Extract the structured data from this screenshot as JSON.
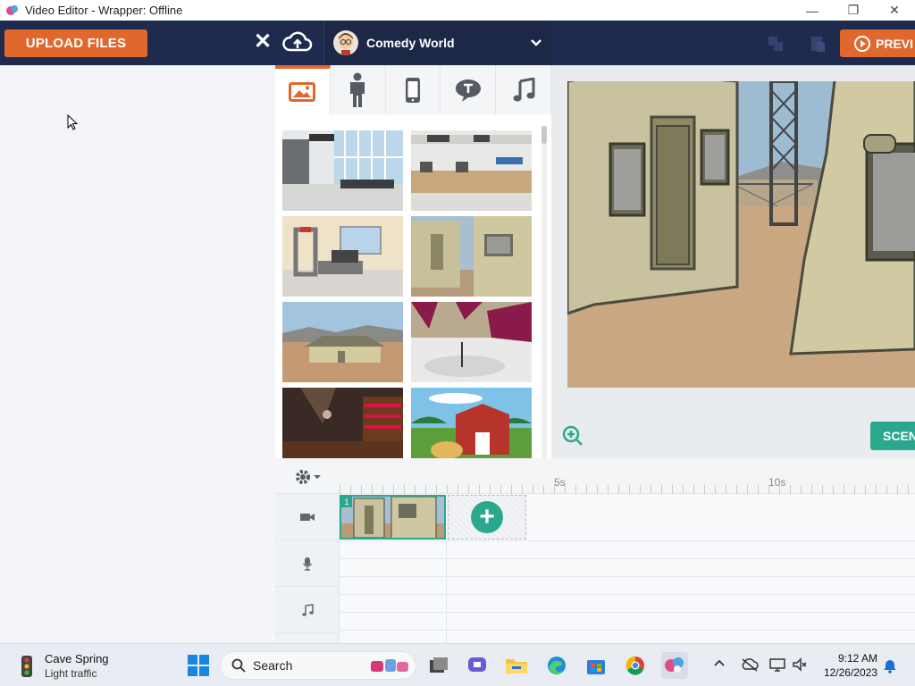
{
  "window": {
    "title": "Video Editor - Wrapper: Offline"
  },
  "toolbar": {
    "upload_label": "UPLOAD FILES",
    "theme_label": "Comedy World",
    "preview_label": "PREVI"
  },
  "library": {
    "tabs": [
      {
        "name": "backgrounds",
        "icon": "image-icon",
        "active": true
      },
      {
        "name": "characters",
        "icon": "person-icon",
        "active": false
      },
      {
        "name": "props",
        "icon": "phone-icon",
        "active": false
      },
      {
        "name": "text",
        "icon": "speech-bubble-icon",
        "active": false
      },
      {
        "name": "sound",
        "icon": "music-note-icon",
        "active": false
      }
    ],
    "thumbnails": [
      "airport-terminal-background",
      "airport-checkin-background",
      "security-checkpoint-background",
      "military-tent-background",
      "desert-camp-background",
      "stage-spotlight-background",
      "night-bar-background",
      "farm-barn-background"
    ]
  },
  "stage": {
    "scene_label": "SCENE"
  },
  "timeline": {
    "ticks": [
      "5s",
      "10s"
    ],
    "scene_number": "1",
    "tracks": [
      "video-track",
      "voice-track",
      "music-track"
    ]
  },
  "taskbar": {
    "weather_location": "Cave Spring",
    "weather_status": "Light traffic",
    "search_label": "Search",
    "time": "9:12 AM",
    "date": "12/26/2023"
  },
  "colors": {
    "accent": "#e0682c",
    "teal": "#2aa88e",
    "navy": "#1f2b4e"
  }
}
